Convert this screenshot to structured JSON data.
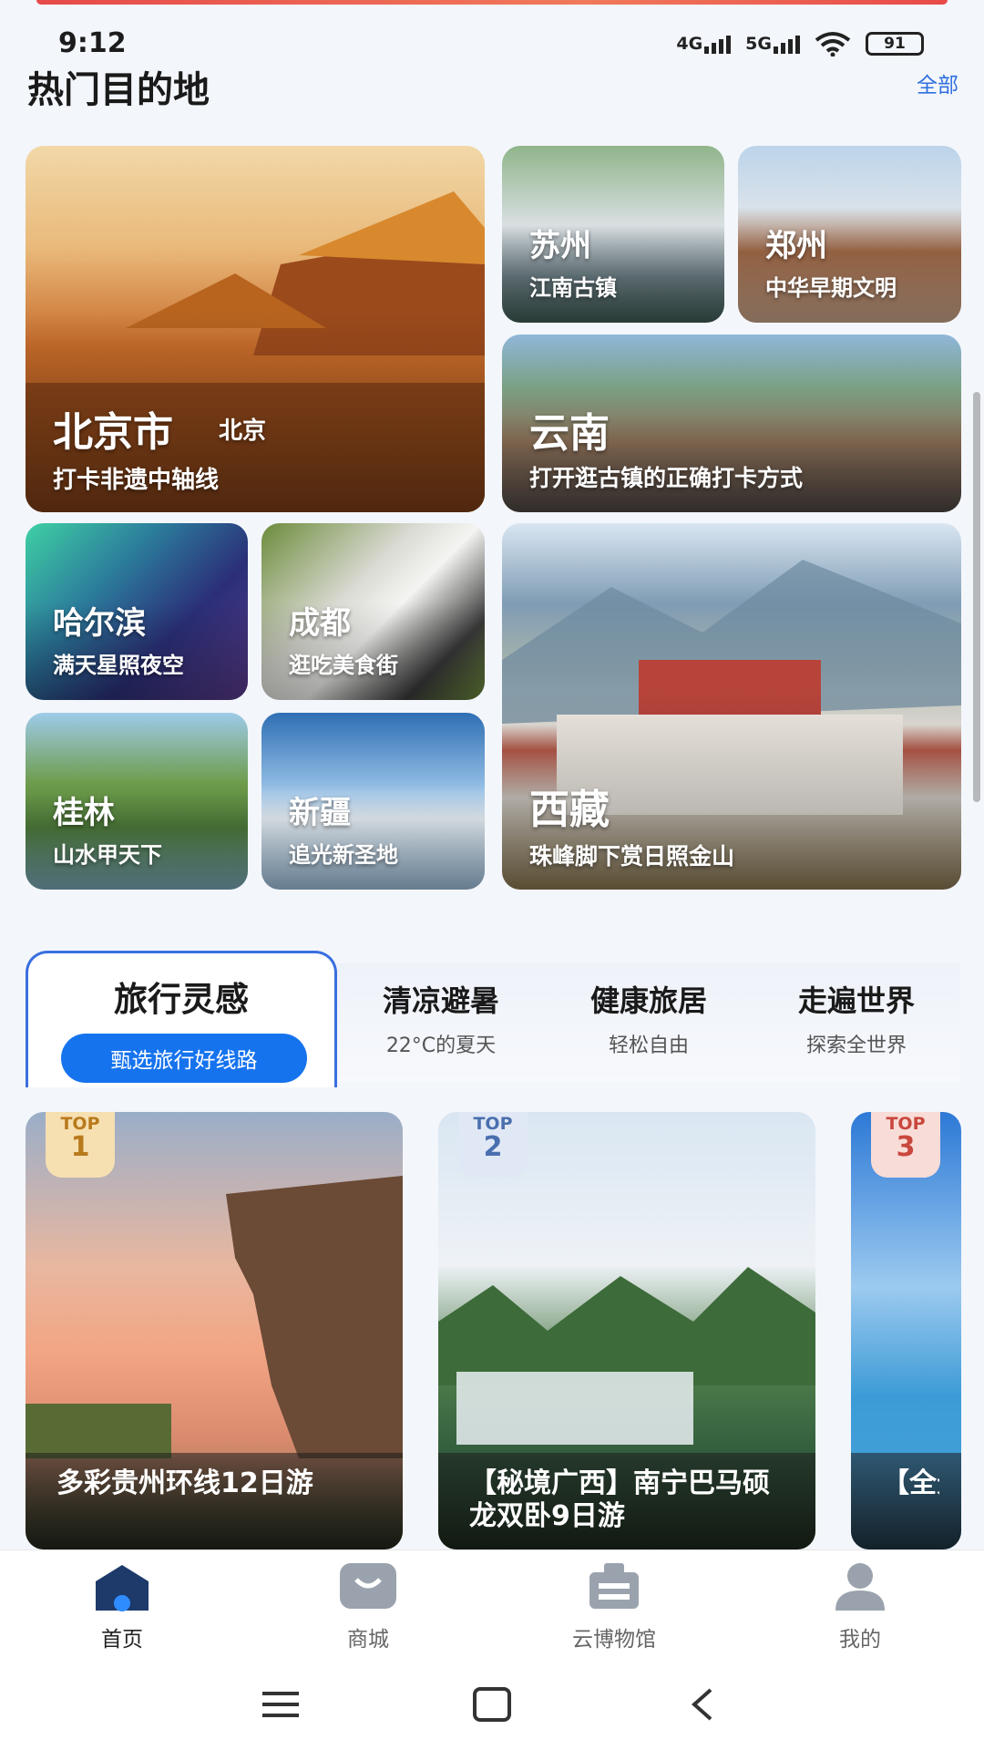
{
  "status": {
    "time": "9:12",
    "net1": "4G",
    "net2": "5G",
    "battery": "91"
  },
  "hot": {
    "title": "热门目的地",
    "all": "全部",
    "destinations": [
      {
        "name": "北京市",
        "tag": "北京",
        "sub": "打卡非遗中轴线"
      },
      {
        "name": "苏州",
        "sub": "江南古镇"
      },
      {
        "name": "郑州",
        "sub": "中华早期文明"
      },
      {
        "name": "云南",
        "sub": "打开逛古镇的正确打卡方式"
      },
      {
        "name": "哈尔滨",
        "sub": "满天星照夜空"
      },
      {
        "name": "成都",
        "sub": "逛吃美食街"
      },
      {
        "name": "西藏",
        "sub": "珠峰脚下赏日照金山"
      },
      {
        "name": "桂林",
        "sub": "山水甲天下"
      },
      {
        "name": "新疆",
        "sub": "追光新圣地"
      }
    ]
  },
  "tabs": {
    "active": {
      "title": "旅行灵感",
      "pill": "甄选旅行好线路"
    },
    "others": [
      {
        "title": "清凉避暑",
        "sub": "22°C的夏天"
      },
      {
        "title": "健康旅居",
        "sub": "轻松自由"
      },
      {
        "title": "走遍世界",
        "sub": "探索全世界"
      }
    ]
  },
  "routes": [
    {
      "top": "TOP",
      "rank": "1",
      "title": "多彩贵州环线12日游"
    },
    {
      "top": "TOP",
      "rank": "2",
      "title": "【秘境广西】南宁巴马硕龙双卧9日游"
    },
    {
      "top": "TOP",
      "rank": "3",
      "title": "【全景】西双"
    }
  ],
  "nav": {
    "items": [
      {
        "label": "首页"
      },
      {
        "label": "商城"
      },
      {
        "label": "云博物馆"
      },
      {
        "label": "我的"
      }
    ]
  },
  "colors": {
    "accent": "#1673ee",
    "link": "#2f6fde"
  }
}
